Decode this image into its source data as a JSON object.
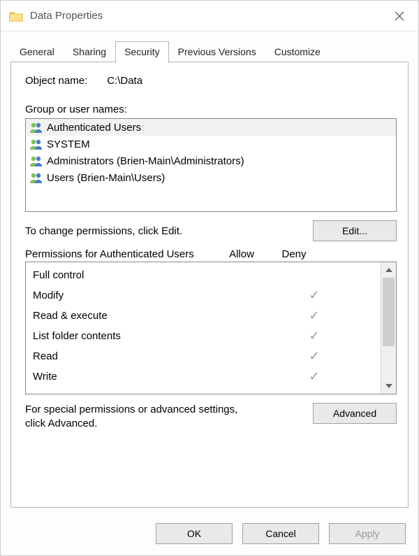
{
  "title": "Data Properties",
  "tabs": {
    "general": "General",
    "sharing": "Sharing",
    "security": "Security",
    "previous": "Previous Versions",
    "customize": "Customize"
  },
  "object": {
    "label": "Object name:",
    "value": "C:\\Data"
  },
  "groups_label": "Group or user names:",
  "groups": [
    {
      "name": "Authenticated Users"
    },
    {
      "name": "SYSTEM"
    },
    {
      "name": "Administrators (Brien-Main\\Administrators)"
    },
    {
      "name": "Users (Brien-Main\\Users)"
    }
  ],
  "edit_hint": "To change permissions, click Edit.",
  "edit_button": "Edit...",
  "perm_header": {
    "left": "Permissions for Authenticated Users",
    "allow": "Allow",
    "deny": "Deny"
  },
  "permissions": [
    {
      "name": "Full control",
      "allow": false,
      "deny": false
    },
    {
      "name": "Modify",
      "allow": true,
      "deny": false
    },
    {
      "name": "Read & execute",
      "allow": true,
      "deny": false
    },
    {
      "name": "List folder contents",
      "allow": true,
      "deny": false
    },
    {
      "name": "Read",
      "allow": true,
      "deny": false
    },
    {
      "name": "Write",
      "allow": true,
      "deny": false
    }
  ],
  "advanced_hint": "For special permissions or advanced settings, click Advanced.",
  "advanced_button": "Advanced",
  "buttons": {
    "ok": "OK",
    "cancel": "Cancel",
    "apply": "Apply"
  }
}
